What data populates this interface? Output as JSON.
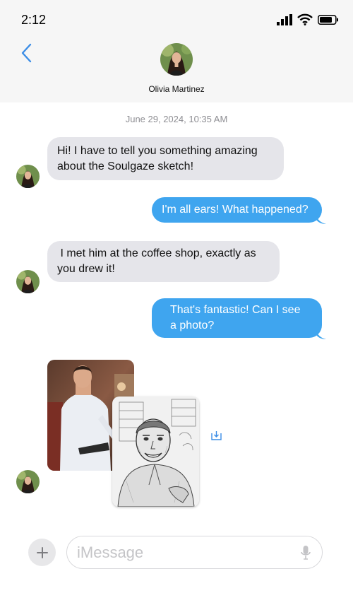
{
  "status_bar": {
    "time": "2:12"
  },
  "header": {
    "contact_name": "Olivia Martinez"
  },
  "conversation": {
    "timestamp": "June 29, 2024, 10:35 AM",
    "messages": [
      {
        "direction": "incoming",
        "line1": "Hi! I have to tell you something amazing",
        "line2": "about the Soulgaze sketch!"
      },
      {
        "direction": "outgoing",
        "line1": "I'm all ears! What happened?"
      },
      {
        "direction": "incoming",
        "line1": " I met him at the coffee shop, exactly as",
        "line2": "you drew it!"
      },
      {
        "direction": "outgoing",
        "line1": "That's fantastic! Can I see",
        "line2": "a photo?"
      }
    ],
    "photos": [
      {
        "description_icon": "photo-man-in-shirt"
      },
      {
        "description_icon": "pencil-sketch-portrait"
      }
    ]
  },
  "input_bar": {
    "placeholder": "iMessage"
  },
  "colors": {
    "accent": "#3fa5ef",
    "incoming_bubble": "#e5e5ea",
    "back_chevron": "#3b8de6"
  }
}
